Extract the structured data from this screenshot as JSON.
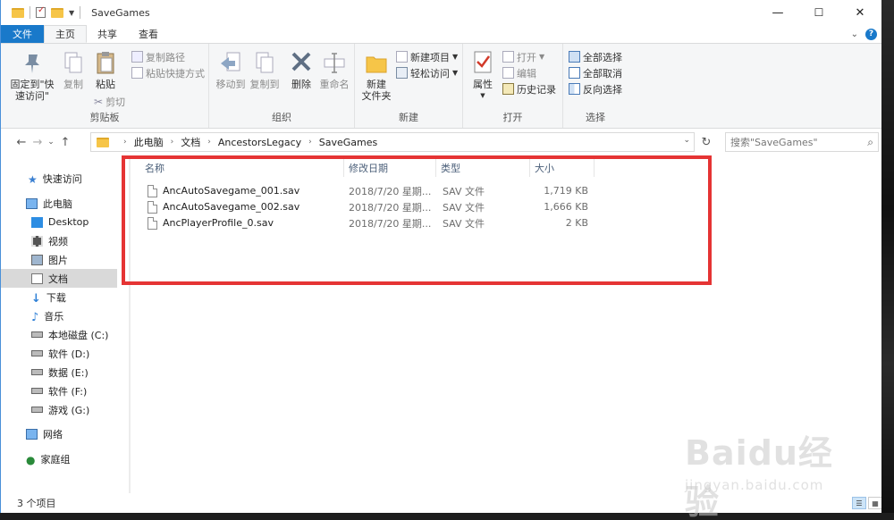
{
  "window": {
    "title": "SaveGames",
    "controls": {
      "minimize": "—",
      "maximize": "☐",
      "close": "✕"
    }
  },
  "ribbon_tabs": [
    "文件",
    "主页",
    "共享",
    "查看"
  ],
  "ribbon": {
    "clipboard": {
      "label": "剪贴板",
      "pin": "固定到\"快\n速访问\"",
      "copy": "复制",
      "paste": "粘贴",
      "copy_path": "复制路径",
      "paste_shortcut": "粘贴快捷方式",
      "cut": "剪切"
    },
    "organize": {
      "label": "组织",
      "move_to": "移动到",
      "copy_to": "复制到",
      "delete": "删除",
      "rename": "重命名"
    },
    "new": {
      "label": "新建",
      "new_folder": "新建\n文件夹",
      "new_item": "新建项目",
      "easy_access": "轻松访问"
    },
    "open": {
      "label": "打开",
      "properties": "属性",
      "open": "打开",
      "edit": "编辑",
      "history": "历史记录"
    },
    "select": {
      "label": "选择",
      "select_all": "全部选择",
      "select_none": "全部取消",
      "invert": "反向选择"
    }
  },
  "address": {
    "crumbs": [
      "此电脑",
      "文档",
      "AncestorsLegacy",
      "SaveGames"
    ],
    "search_placeholder": "搜索\"SaveGames\""
  },
  "nav_pane": [
    {
      "label": "快速访问",
      "icon": "star-icon"
    },
    {
      "label": "此电脑",
      "icon": "computer-icon"
    },
    {
      "label": "Desktop",
      "icon": "desktop-icon"
    },
    {
      "label": "视频",
      "icon": "video-icon"
    },
    {
      "label": "图片",
      "icon": "pictures-icon"
    },
    {
      "label": "文档",
      "icon": "documents-icon"
    },
    {
      "label": "下载",
      "icon": "download-icon"
    },
    {
      "label": "音乐",
      "icon": "music-icon"
    },
    {
      "label": "本地磁盘 (C:)",
      "icon": "drive-icon"
    },
    {
      "label": "软件 (D:)",
      "icon": "drive-icon"
    },
    {
      "label": "数据 (E:)",
      "icon": "drive-icon"
    },
    {
      "label": "软件 (F:)",
      "icon": "drive-icon"
    },
    {
      "label": "游戏 (G:)",
      "icon": "drive-icon"
    },
    {
      "label": "网络",
      "icon": "network-icon"
    },
    {
      "label": "家庭组",
      "icon": "homegroup-icon"
    }
  ],
  "columns": [
    "名称",
    "修改日期",
    "类型",
    "大小"
  ],
  "files": [
    {
      "name": "AncAutoSavegame_001.sav",
      "date": "2018/7/20 星期...",
      "type": "SAV 文件",
      "size": "1,719 KB"
    },
    {
      "name": "AncAutoSavegame_002.sav",
      "date": "2018/7/20 星期...",
      "type": "SAV 文件",
      "size": "1,666 KB"
    },
    {
      "name": "AncPlayerProfile_0.sav",
      "date": "2018/7/20 星期...",
      "type": "SAV 文件",
      "size": "2 KB"
    }
  ],
  "status": {
    "item_count": "3 个项目"
  },
  "watermark": {
    "brand": "Baidu经验",
    "site": "jingyan.baidu.com"
  },
  "colors": {
    "accent": "#1979ca",
    "highlight_box": "#e53434",
    "selected": "#d9d9d9"
  }
}
